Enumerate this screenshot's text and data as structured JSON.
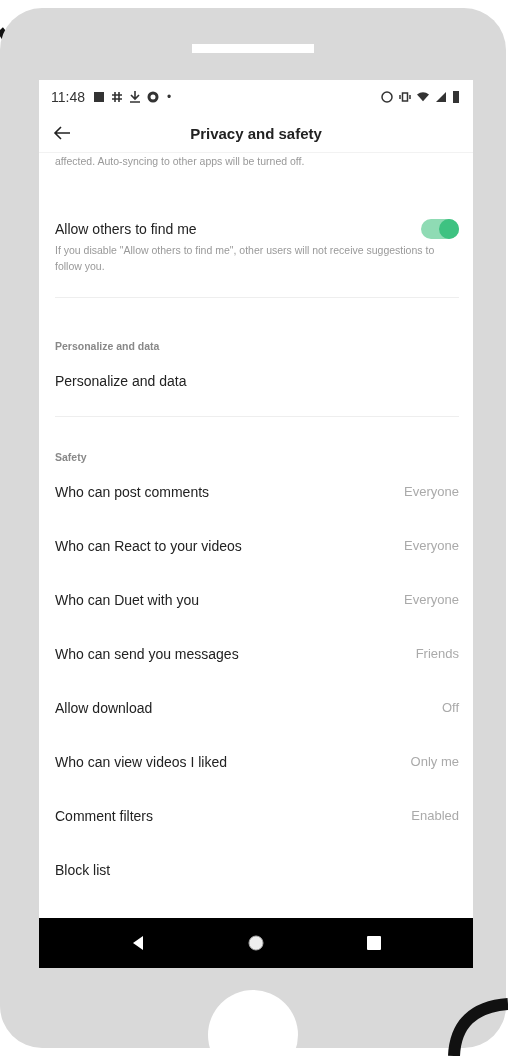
{
  "status_bar": {
    "time": "11:48",
    "dot": "•"
  },
  "header": {
    "title": "Privacy and safety"
  },
  "cut_text": "affected. Auto-syncing to other apps will be turned off.",
  "toggle": {
    "label": "Allow others to find me",
    "on": true,
    "description": "If you disable \"Allow others to find me\", other users will not receive suggestions to follow you."
  },
  "sections": [
    {
      "title": "Personalize and data",
      "rows": [
        {
          "label": "Personalize and data"
        }
      ]
    },
    {
      "title": "Safety",
      "rows": [
        {
          "label": "Who can post comments",
          "value": "Everyone"
        },
        {
          "label": "Who can React to your videos",
          "value": "Everyone"
        },
        {
          "label": "Who can Duet with you",
          "value": "Everyone"
        },
        {
          "label": "Who can send you messages",
          "value": "Friends"
        },
        {
          "label": "Allow download",
          "value": "Off"
        },
        {
          "label": "Who can view videos I liked",
          "value": "Only me"
        },
        {
          "label": "Comment filters",
          "value": "Enabled"
        },
        {
          "label": "Block list"
        }
      ]
    }
  ]
}
